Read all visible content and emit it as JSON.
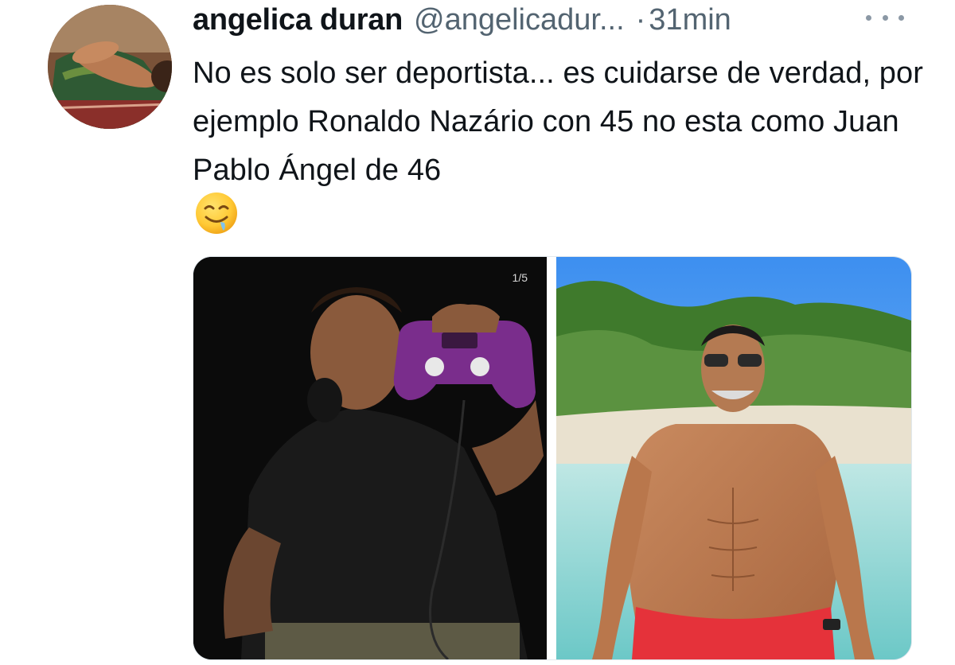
{
  "tweet": {
    "author": {
      "name": "angelica duran",
      "handle": "@angelicadur...",
      "avatar_icon": "profile-photo"
    },
    "separator": "·",
    "time": "31min",
    "more_icon": "more-options-icon",
    "text": "No es solo ser deportista... es cuidarse de verdad, por ejemplo Ronaldo Nazário con 45 no esta como Juan Pablo Ángel de 46",
    "emoji": "drooling-face-emoji",
    "media": {
      "photos": [
        {
          "image_counter": "1/5"
        },
        {}
      ]
    }
  },
  "colors": {
    "text_primary": "#0f1419",
    "text_secondary": "#536471",
    "background": "#ffffff"
  }
}
